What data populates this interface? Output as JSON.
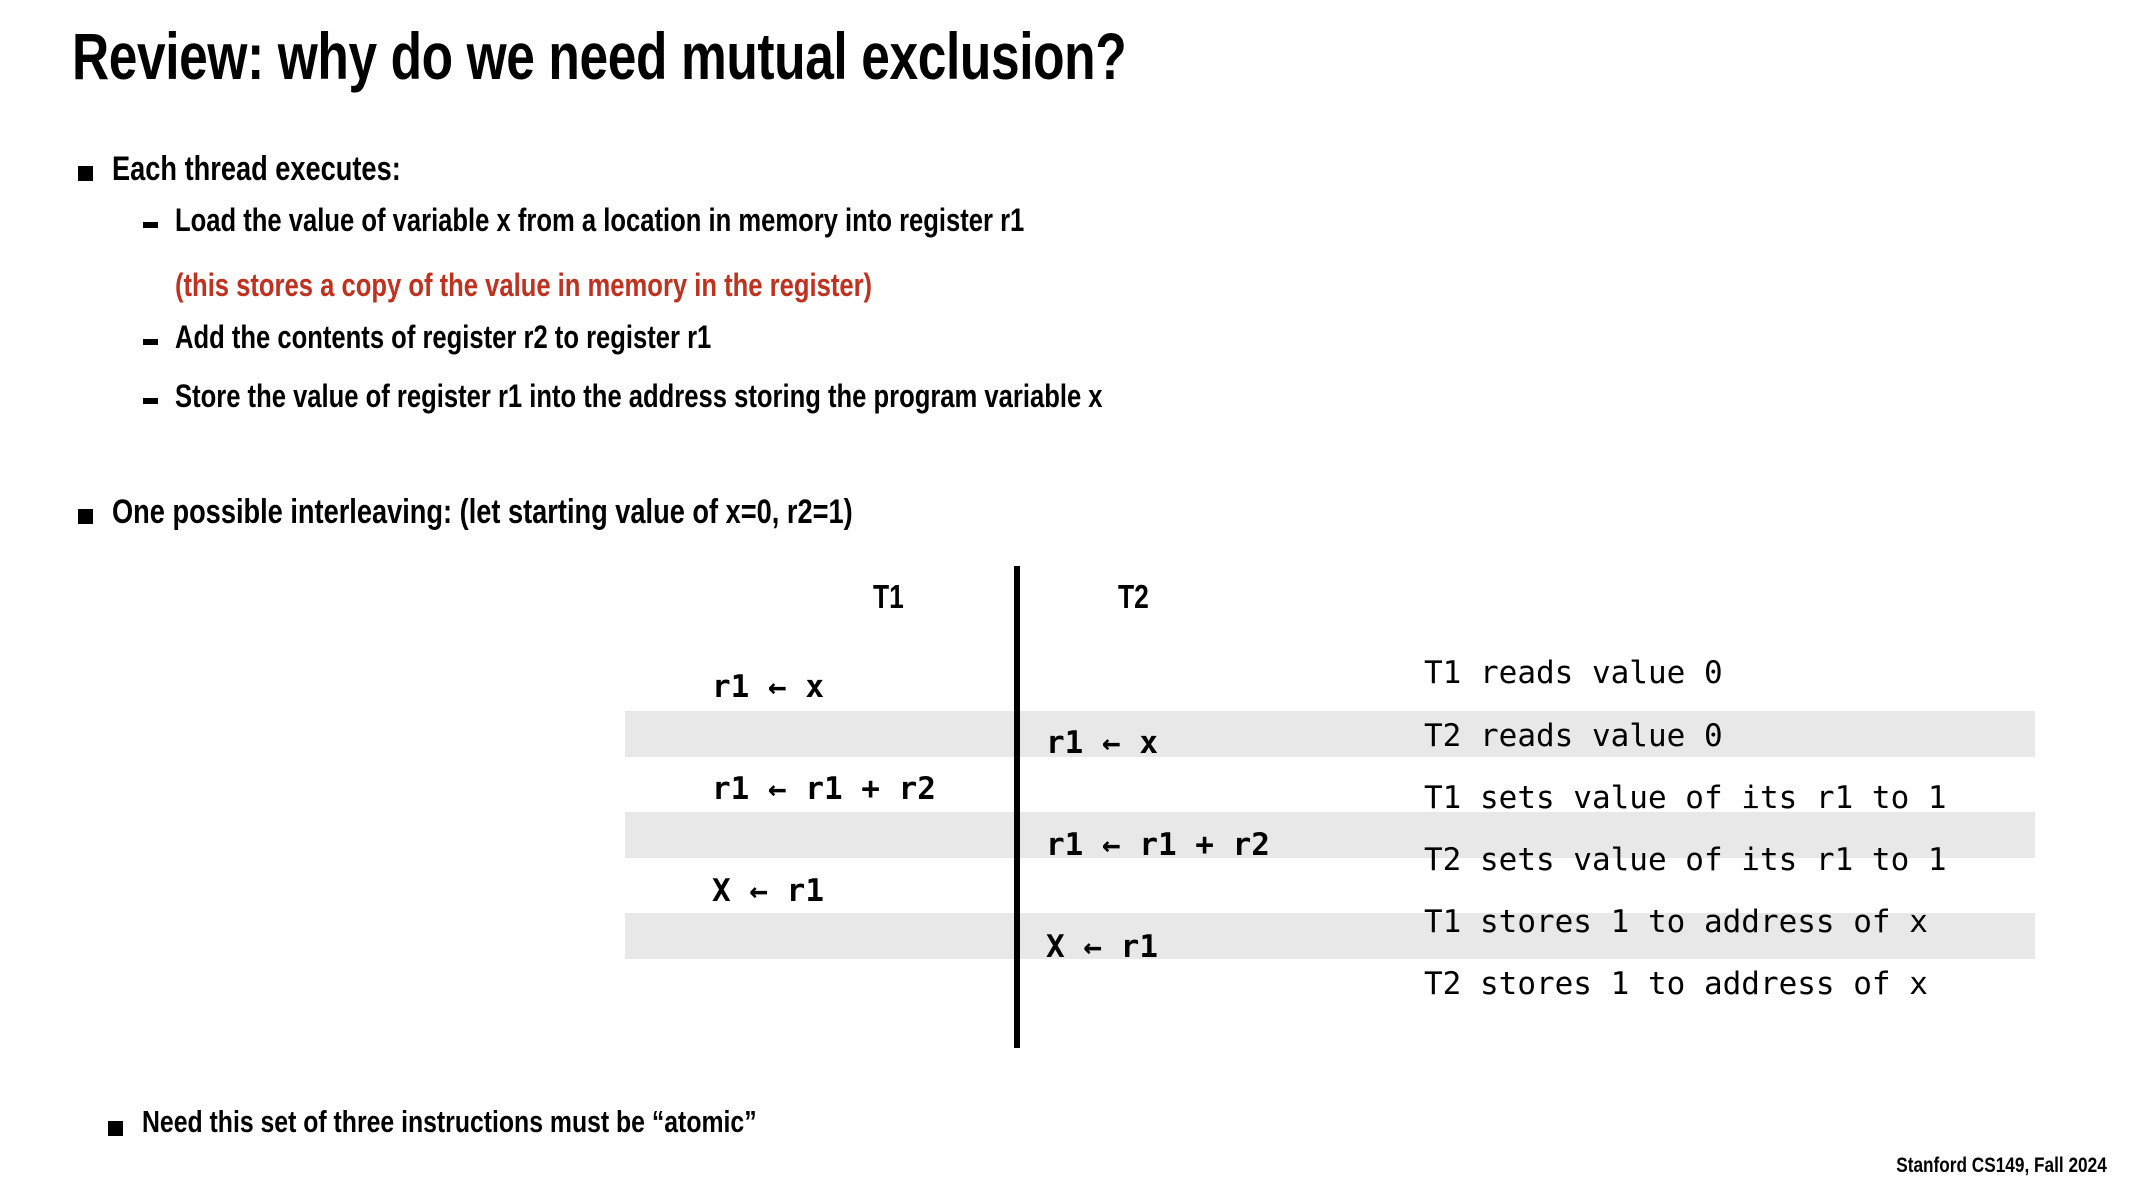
{
  "slide": {
    "title": "Review: why do we need mutual exclusion?",
    "footer": "Stanford CS149, Fall 2024",
    "accent_red": "#c0311e",
    "stripe_color": "#e8e8e8"
  },
  "bullets": {
    "each_thread": "Each thread executes:",
    "steps": [
      "Load the value of variable x from a location in memory into register r1",
      "Add the contents of register r2 to register r1",
      "Store the value of register r1 into the address storing the program variable x"
    ],
    "step1_note": "(this stores a copy of the value in memory in the register)",
    "interleaving": "One possible interleaving: (let starting value of x=0, r2=1)",
    "atomic_note": "Need this set of three instructions must be “atomic”"
  },
  "table": {
    "headers": {
      "t1": "T1",
      "t2": "T2"
    },
    "rows": [
      {
        "thread": "T1",
        "instruction": "r1 ← x",
        "annotation": "T1 reads value 0",
        "shaded": false
      },
      {
        "thread": "T2",
        "instruction": "r1 ← x",
        "annotation": "T2 reads value 0",
        "shaded": true
      },
      {
        "thread": "T1",
        "instruction": "r1 ← r1 + r2",
        "annotation": "T1 sets value of its r1 to 1",
        "shaded": false
      },
      {
        "thread": "T2",
        "instruction": "r1 ← r1 + r2",
        "annotation": "T2 sets value of its r1 to 1",
        "shaded": true
      },
      {
        "thread": "T1",
        "instruction": "X ← r1",
        "annotation": "T1 stores 1 to address of x",
        "shaded": false
      },
      {
        "thread": "T2",
        "instruction": "X ← r1",
        "annotation": "T2 stores 1 to address of x",
        "shaded": true
      }
    ]
  }
}
